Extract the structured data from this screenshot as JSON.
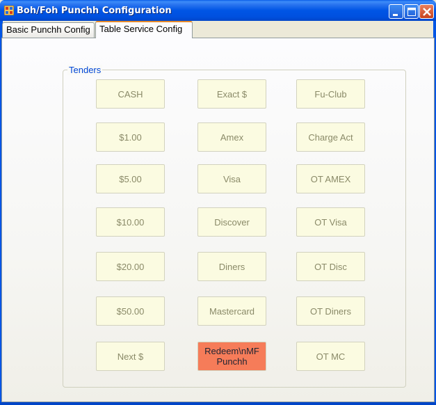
{
  "window": {
    "title": "Boh/Foh Punchh Configuration",
    "icon": "app-icon"
  },
  "tabs": [
    {
      "label": "Basic Punchh Config",
      "active": false
    },
    {
      "label": "Table Service Config",
      "active": true
    }
  ],
  "tenders_group": {
    "legend": "Tenders",
    "buttons": [
      "CASH",
      "Exact $",
      "Fu-Club",
      "$1.00",
      "Amex",
      "Charge Act",
      "$5.00",
      "Visa",
      "OT AMEX",
      "$10.00",
      "Discover",
      "OT Visa",
      "$20.00",
      "Diners",
      "OT Disc",
      "$50.00",
      "Mastercard",
      "OT Diners",
      "Next $",
      "Redeem\\nMF Punchh",
      "OT MC"
    ],
    "highlighted_button": "Redeem\\nMF Punchh"
  },
  "colors": {
    "titlebar": "#0055e5",
    "tender_bg": "#fbfbe1",
    "tender_text": "#8a8a68",
    "highlight_bg": "#f67c59",
    "legend_text": "#0046d5",
    "active_tab_accent": "#e68b2c"
  }
}
